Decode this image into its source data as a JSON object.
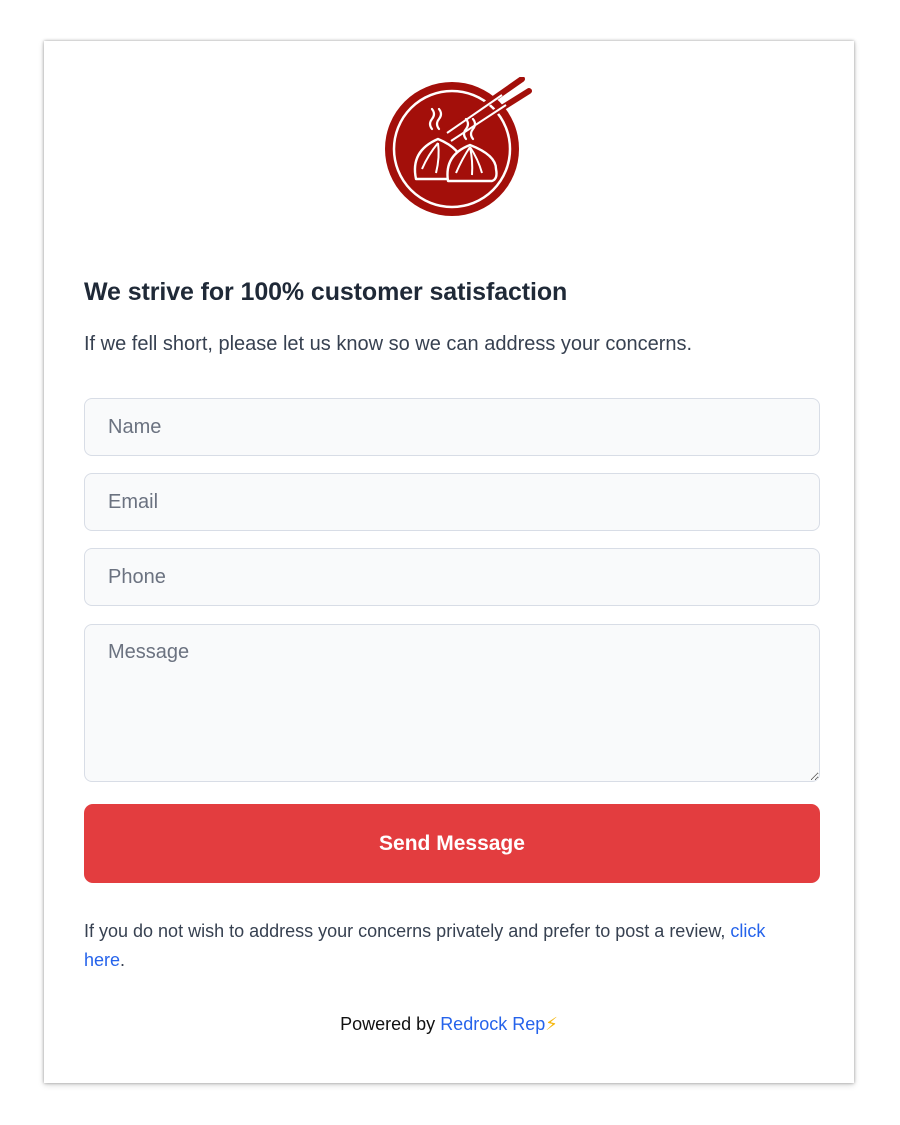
{
  "logo": {
    "icon": "dumplings-chopsticks-icon",
    "colors": {
      "circle": "#a30f0a",
      "ring": "#ffffff",
      "chopsticks": "#a30f0a"
    }
  },
  "heading": "We strive for 100% customer satisfaction",
  "subheading": "If we fell short, please let us know so we can address your concerns.",
  "form": {
    "name_placeholder": "Name",
    "email_placeholder": "Email",
    "phone_placeholder": "Phone",
    "message_placeholder": "Message",
    "send_label": "Send Message"
  },
  "review_note": {
    "text": "If you do not wish to address your concerns privately and prefer to post a review, ",
    "link_label": "click here",
    "end": "."
  },
  "footer": {
    "powered_by": "Powered by ",
    "brand": "Redrock Rep",
    "bolt": "⚡"
  },
  "colors": {
    "accent": "#e33d3f",
    "link": "#2563eb",
    "bolt": "#f5b70f"
  }
}
